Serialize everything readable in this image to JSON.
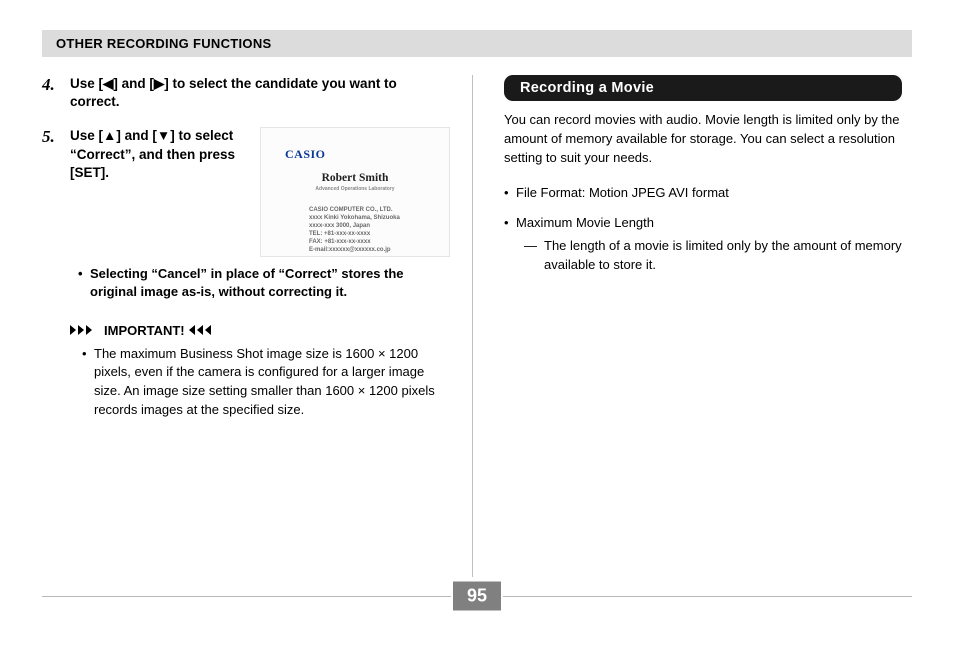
{
  "header_title": "OTHER RECORDING FUNCTIONS",
  "left": {
    "step4_num": "4.",
    "step4_text": "Use [◀] and [▶] to select the candidate you want to correct.",
    "step5_num": "5.",
    "step5_text": "Use [▲] and [▼] to select “Correct”, and then press [SET].",
    "step5_sub": "Selecting “Cancel” in place of “Correct” stores the original image as-is, without correcting it.",
    "important_label": "IMPORTANT!",
    "important_text": "The maximum Business Shot image size is 1600 × 1200 pixels, even if the camera is configured for a larger image size. An image size setting smaller than 1600 × 1200 pixels records images at the specified size.",
    "card": {
      "logo": "CASIO",
      "name": "Robert Smith",
      "subtitle": "Advanced Operations Laboratory",
      "line1": "CASIO COMPUTER CO., LTD.",
      "line2": "xxxx Kinki Yokohama, Shizuoka",
      "line3": "xxxx-xxx 3000, Japan",
      "line4": "TEL: +81-xxx-xx-xxxx",
      "line5": "FAX: +81-xxx-xx-xxxx",
      "line6": "E-mail:xxxxxx@xxxxxx.co.jp"
    }
  },
  "right": {
    "heading": "Recording a Movie",
    "intro": "You can record movies with audio. Movie length is limited only by the amount of memory available for storage. You can select a resolution setting to suit your needs.",
    "bullet1": "File Format: Motion JPEG AVI format",
    "bullet2": "Maximum Movie Length",
    "bullet2_sub": "The length of a movie is limited only by the amount of memory available to store it."
  },
  "page_number": "95"
}
